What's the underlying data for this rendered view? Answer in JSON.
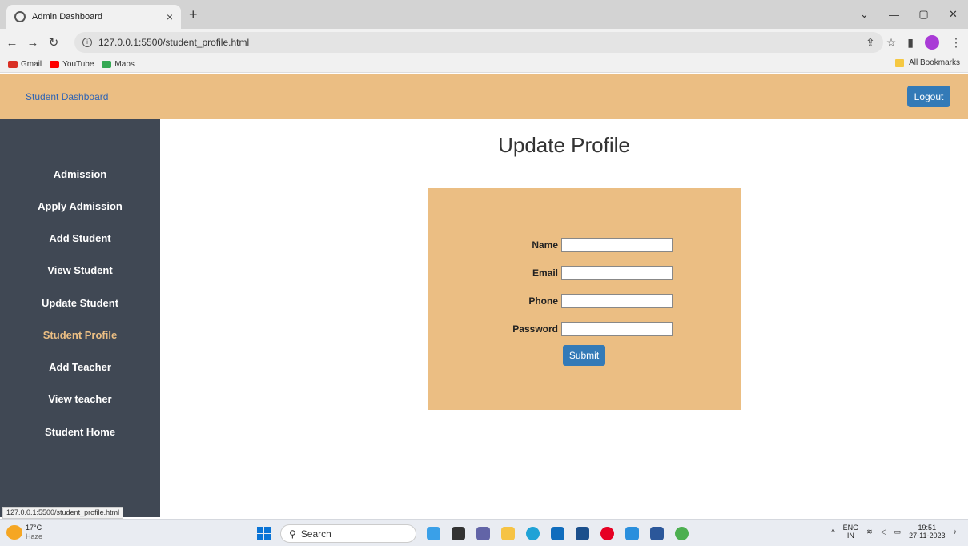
{
  "browser": {
    "tab_title": "Admin Dashboard",
    "url": "127.0.0.1:5500/student_profile.html",
    "bookmarks": [
      "Gmail",
      "YouTube",
      "Maps"
    ],
    "all_bookmarks": "All Bookmarks",
    "status_url": "127.0.0.1:5500/student_profile.html"
  },
  "navbar": {
    "brand": "Student Dashboard",
    "logout": "Logout"
  },
  "sidebar": {
    "items": [
      {
        "label": "Admission"
      },
      {
        "label": "Apply Admission"
      },
      {
        "label": "Add Student"
      },
      {
        "label": "View Student"
      },
      {
        "label": "Update Student"
      },
      {
        "label": "Student Profile",
        "active": true
      },
      {
        "label": "Add Teacher"
      },
      {
        "label": "View teacher"
      },
      {
        "label": "Student Home"
      }
    ]
  },
  "main": {
    "title": "Update Profile",
    "fields": [
      {
        "label": "Name",
        "value": ""
      },
      {
        "label": "Email",
        "value": ""
      },
      {
        "label": "Phone",
        "value": ""
      },
      {
        "label": "Password",
        "value": ""
      }
    ],
    "submit": "Submit"
  },
  "taskbar": {
    "weather_temp": "17°C",
    "weather_desc": "Haze",
    "search": "Search",
    "lang": "ENG",
    "region": "IN",
    "time": "19:51",
    "date": "27-11-2023"
  },
  "colors": {
    "accent": "#ebbe83",
    "sidebar": "#404854",
    "button": "#337ab7"
  }
}
